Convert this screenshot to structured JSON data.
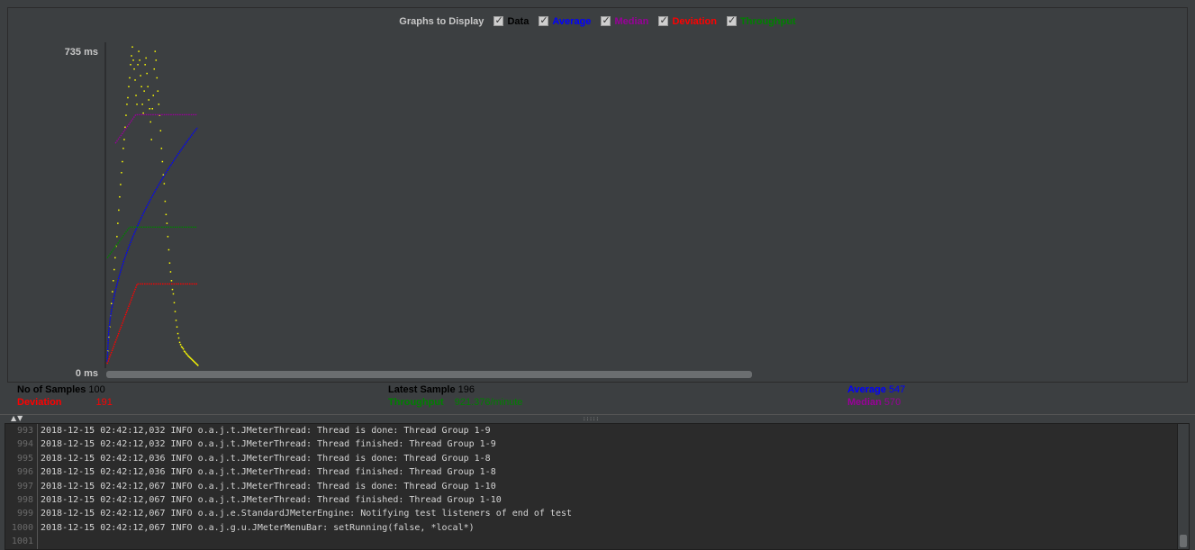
{
  "legend": {
    "title": "Graphs to Display",
    "items": [
      {
        "label": "Data",
        "color": "#000000"
      },
      {
        "label": "Average",
        "color": "#0000ff"
      },
      {
        "label": "Median",
        "color": "#990099"
      },
      {
        "label": "Deviation",
        "color": "#ff0000"
      },
      {
        "label": "Throughput",
        "color": "#008000"
      }
    ]
  },
  "chart_data": {
    "type": "scatter",
    "ylabel_max": "735 ms",
    "ylabel_min": "0 ms",
    "ylim": [
      0,
      735
    ],
    "x_samples": 100,
    "series": [
      {
        "name": "Data",
        "color": "#ffff00",
        "points": [
          [
            1,
            40
          ],
          [
            2,
            72
          ],
          [
            3,
            95
          ],
          [
            4,
            120
          ],
          [
            5,
            148
          ],
          [
            6,
            175
          ],
          [
            7,
            200
          ],
          [
            8,
            225
          ],
          [
            9,
            252
          ],
          [
            10,
            278
          ],
          [
            11,
            300
          ],
          [
            12,
            330
          ],
          [
            13,
            360
          ],
          [
            14,
            390
          ],
          [
            15,
            418
          ],
          [
            16,
            445
          ],
          [
            17,
            470
          ],
          [
            18,
            500
          ],
          [
            19,
            520
          ],
          [
            20,
            548
          ],
          [
            21,
            575
          ],
          [
            22,
            600
          ],
          [
            23,
            615
          ],
          [
            24,
            640
          ],
          [
            25,
            660
          ],
          [
            26,
            690
          ],
          [
            27,
            710
          ],
          [
            28,
            730
          ],
          [
            29,
            700
          ],
          [
            30,
            680
          ],
          [
            31,
            655
          ],
          [
            32,
            620
          ],
          [
            33,
            600
          ],
          [
            34,
            690
          ],
          [
            35,
            720
          ],
          [
            36,
            700
          ],
          [
            37,
            665
          ],
          [
            38,
            640
          ],
          [
            39,
            600
          ],
          [
            40,
            580
          ],
          [
            41,
            630
          ],
          [
            42,
            690
          ],
          [
            43,
            705
          ],
          [
            44,
            670
          ],
          [
            45,
            640
          ],
          [
            46,
            610
          ],
          [
            47,
            590
          ],
          [
            48,
            560
          ],
          [
            49,
            520
          ],
          [
            50,
            590
          ],
          [
            51,
            620
          ],
          [
            52,
            680
          ],
          [
            53,
            720
          ],
          [
            54,
            700
          ],
          [
            55,
            660
          ],
          [
            56,
            630
          ],
          [
            57,
            600
          ],
          [
            58,
            575
          ],
          [
            59,
            540
          ],
          [
            60,
            500
          ],
          [
            61,
            470
          ],
          [
            62,
            440
          ],
          [
            63,
            420
          ],
          [
            64,
            380
          ],
          [
            65,
            350
          ],
          [
            66,
            330
          ],
          [
            67,
            300
          ],
          [
            68,
            270
          ],
          [
            69,
            240
          ],
          [
            70,
            220
          ],
          [
            71,
            200
          ],
          [
            72,
            180
          ],
          [
            73,
            170
          ],
          [
            74,
            150
          ],
          [
            75,
            130
          ],
          [
            76,
            110
          ],
          [
            77,
            95
          ],
          [
            78,
            80
          ],
          [
            79,
            70
          ],
          [
            80,
            60
          ],
          [
            81,
            55
          ],
          [
            82,
            50
          ],
          [
            83,
            48
          ],
          [
            84,
            45
          ],
          [
            85,
            40
          ],
          [
            86,
            38
          ],
          [
            87,
            35
          ],
          [
            88,
            33
          ],
          [
            89,
            30
          ],
          [
            90,
            28
          ],
          [
            91,
            26
          ],
          [
            92,
            24
          ],
          [
            93,
            22
          ],
          [
            94,
            20
          ],
          [
            95,
            18
          ],
          [
            96,
            16
          ],
          [
            97,
            14
          ],
          [
            98,
            12
          ],
          [
            99,
            10
          ],
          [
            100,
            8
          ]
        ]
      },
      {
        "name": "Average",
        "color": "#0000ff",
        "values_start_end": [
          [
            1,
            15
          ],
          [
            100,
            545
          ]
        ]
      },
      {
        "name": "Median",
        "color": "#990099",
        "values_start_end": [
          [
            10,
            510
          ],
          [
            100,
            575
          ]
        ]
      },
      {
        "name": "Deviation",
        "color": "#ff0000",
        "values_start_end": [
          [
            1,
            10
          ],
          [
            100,
            191
          ]
        ]
      },
      {
        "name": "Throughput",
        "color": "#008000",
        "values_start_end": [
          [
            1,
            250
          ],
          [
            100,
            320
          ]
        ]
      }
    ]
  },
  "stats": {
    "samples_label": "No of Samples",
    "samples_value": "100",
    "deviation_label": "Deviation",
    "deviation_value": "191",
    "latest_label": "Latest Sample",
    "latest_value": "196",
    "throughput_label": "Throughput",
    "throughput_value": "921.376/minute",
    "average_label": "Average",
    "average_value": "547",
    "median_label": "Median",
    "median_value": "570"
  },
  "log": {
    "lines": [
      {
        "n": "993",
        "text": "2018-12-15 02:42:12,032 INFO o.a.j.t.JMeterThread: Thread is done: Thread Group 1-9"
      },
      {
        "n": "994",
        "text": "2018-12-15 02:42:12,032 INFO o.a.j.t.JMeterThread: Thread finished: Thread Group 1-9"
      },
      {
        "n": "995",
        "text": "2018-12-15 02:42:12,036 INFO o.a.j.t.JMeterThread: Thread is done: Thread Group 1-8"
      },
      {
        "n": "996",
        "text": "2018-12-15 02:42:12,036 INFO o.a.j.t.JMeterThread: Thread finished: Thread Group 1-8"
      },
      {
        "n": "997",
        "text": "2018-12-15 02:42:12,067 INFO o.a.j.t.JMeterThread: Thread is done: Thread Group 1-10"
      },
      {
        "n": "998",
        "text": "2018-12-15 02:42:12,067 INFO o.a.j.t.JMeterThread: Thread finished: Thread Group 1-10"
      },
      {
        "n": "999",
        "text": "2018-12-15 02:42:12,067 INFO o.a.j.e.StandardJMeterEngine: Notifying test listeners of end of test"
      },
      {
        "n": "1000",
        "text": "2018-12-15 02:42:12,067 INFO o.a.j.g.u.JMeterMenuBar: setRunning(false, *local*)"
      },
      {
        "n": "1001",
        "text": ""
      }
    ]
  },
  "colors": {
    "background": "#3c3f41",
    "log_bg": "#2b2b2b",
    "data_points": "#ffff00"
  }
}
